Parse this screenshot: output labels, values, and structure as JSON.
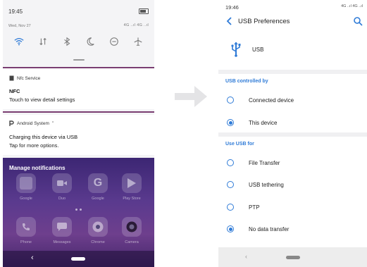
{
  "left_phone": {
    "status": {
      "time": "19:45",
      "date": "Wed, Nov 27",
      "signal": "4G ..ıl 4G ..ıl"
    },
    "quick_settings": [
      "wifi-icon",
      "data-icon",
      "bluetooth-icon",
      "moon-icon",
      "dnd-icon",
      "airplane-icon"
    ],
    "notification_nfc": {
      "app": "Nfc Service",
      "title": "NFC",
      "text": "Touch to view detail settings"
    },
    "notification_usb": {
      "app": "Android System",
      "title": "Charging this device via USB",
      "text": "Tap for more options."
    },
    "manage_label": "Manage notifications",
    "apps_row1": [
      "Google",
      "Duo",
      "Google",
      "Play Store"
    ],
    "apps_row2": [
      "Phone",
      "Messages",
      "Chrome",
      "Camera"
    ],
    "nav_back": "‹"
  },
  "right_phone": {
    "status": {
      "time": "19:46",
      "signal": "4G ..ıl 4G ..ıl"
    },
    "title": "USB Preferences",
    "usb_label": "USB",
    "section_controlled": "USB controlled by",
    "controlled_options": [
      {
        "label": "Connected device",
        "selected": false
      },
      {
        "label": "This device",
        "selected": true
      }
    ],
    "section_use": "Use USB for",
    "use_options": [
      {
        "label": "File Transfer",
        "selected": false
      },
      {
        "label": "USB tethering",
        "selected": false
      },
      {
        "label": "PTP",
        "selected": false
      },
      {
        "label": "No data transfer",
        "selected": true
      }
    ],
    "nav_back": "‹"
  },
  "colors": {
    "accent": "#2f7bd7",
    "divider": "#7a3e72"
  }
}
